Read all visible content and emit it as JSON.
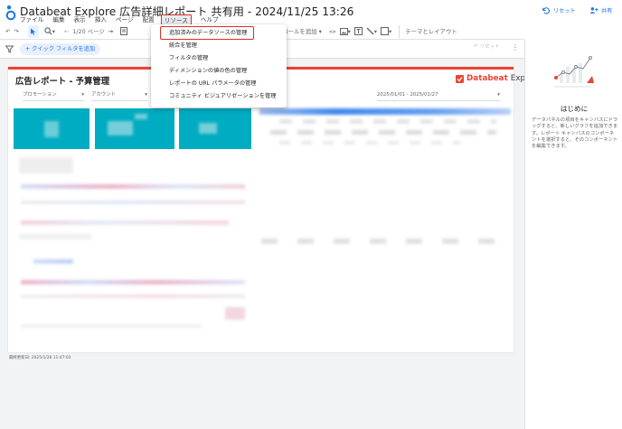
{
  "header": {
    "title": "Databeat Explore 広告詳細レポート 共有用 - 2024/11/25 13:26",
    "reset_label": "リセット",
    "share_label": "共有"
  },
  "menu": {
    "items": [
      "ファイル",
      "編集",
      "表示",
      "挿入",
      "ページ",
      "配置",
      "リソース",
      "ヘルプ"
    ],
    "active": "リソース"
  },
  "toolbar": {
    "page_indicator": "1/20 ページ",
    "add_control_label": "コントロールを追加",
    "theme_layout_label": "テーマとレイアウト"
  },
  "filter_bar": {
    "quick_filter_label": "+ クイック フィルタを追加",
    "reset_label": "リセット"
  },
  "report": {
    "title": "広告レポート - 予算管理",
    "brand_name": "Databeat",
    "brand_suffix": "Explore",
    "control_1": "プロモーション",
    "control_2": "アカウント",
    "date_range": "2025/01/01 - 2025/01/27",
    "footer_note": "最終更新日: 2025/1/28 11:47:03"
  },
  "resource_menu": {
    "items": [
      "追加済みのデータソースの管理",
      "統合を管理",
      "フィルタの管理",
      "ディメンションの値の色の管理",
      "レポートの URL パラメータの管理",
      "コミュニティ ビジュアリゼーションを管理"
    ],
    "highlighted": "追加済みのデータソースの管理"
  },
  "right_panel": {
    "heading": "はじめに",
    "description": "データパネルの項目をキャンバスにドラッグすると、新しいグラフを追加できます。レポート キャンバスのコンポーネントを選択すると、そのコンポーネントを編集できます。"
  },
  "colors": {
    "accent": "#1a73e8",
    "brand_red": "#ea4335",
    "highlight_border": "#d93025",
    "scorecard_teal": "#00acc1"
  },
  "icons": [
    "logo-icon",
    "reset-icon",
    "share-icon",
    "undo-icon",
    "redo-icon",
    "select-icon",
    "zoom-icon",
    "prev-page-icon",
    "next-page-icon",
    "code-icon",
    "image-icon",
    "text-icon",
    "line-icon",
    "shape-icon",
    "filter-icon",
    "more-icon",
    "chart-illustration"
  ]
}
